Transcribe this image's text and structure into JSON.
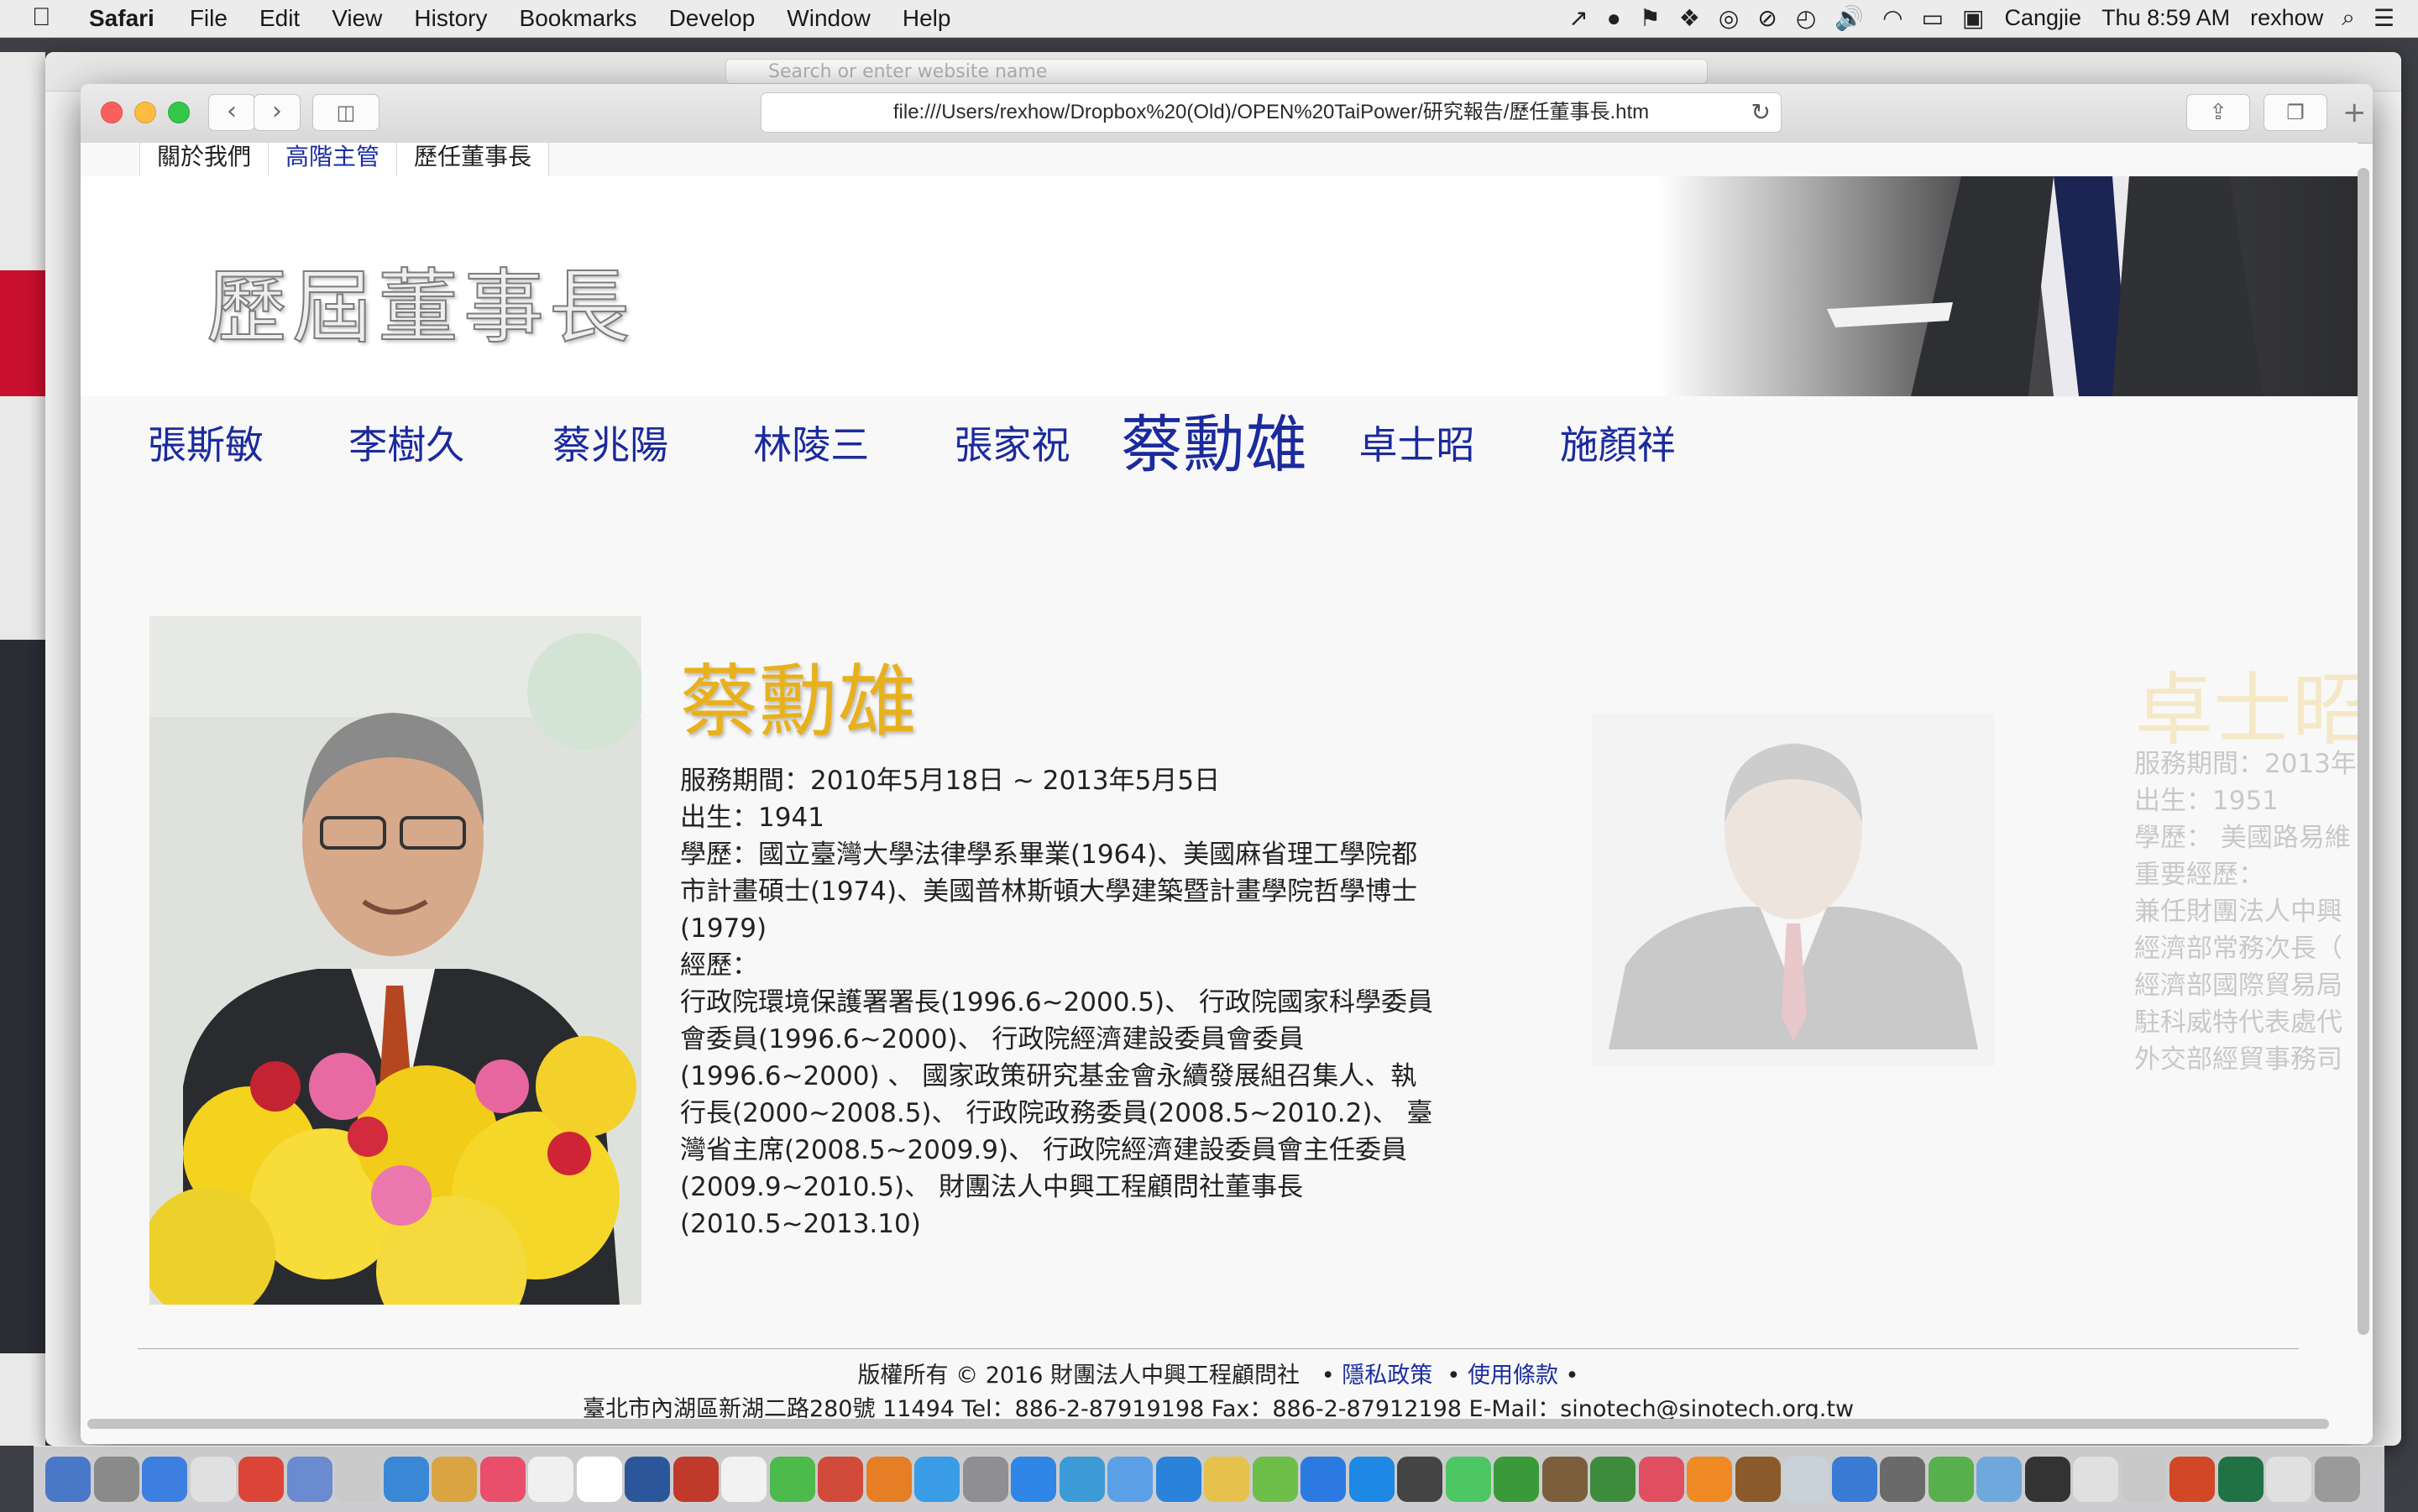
{
  "menubar": {
    "app_name": "Safari",
    "menus": [
      "File",
      "Edit",
      "View",
      "History",
      "Bookmarks",
      "Develop",
      "Window",
      "Help"
    ],
    "input_method": "Cangjie",
    "clock": "Thu 8:59 AM",
    "user": "rexhow"
  },
  "browser": {
    "url": "file:///Users/rexhow/Dropbox%20(Old)/OPEN%20TaiPower/研究報告/歷任董事長.htm",
    "background_placeholder": "Search or enter website name"
  },
  "page": {
    "top_nav": [
      "關於我們",
      "高階主管",
      "歷任董事長"
    ],
    "active_top_nav": "高階主管",
    "title": "歷屆董事長",
    "chairmen": [
      "張斯敏",
      "李樹久",
      "蔡兆陽",
      "林陵三",
      "張家祝",
      "蔡勳雄",
      "卓士昭",
      "施顏祥"
    ],
    "active_chairman": "蔡勳雄",
    "current": {
      "name": "蔡勳雄",
      "bio": [
        "服務期間：2010年5月18日 ~ 2013年5月5日",
        "出生：1941",
        "學歷：國立臺灣大學法律學系畢業(1964)、美國麻省理工學院都市計畫碩士(1974)、美國普林斯頓大學建築暨計畫學院哲學博士(1979)",
        "經歷：",
        "行政院環境保護署署長(1996.6~2000.5)、 行政院國家科學委員會委員(1996.6~2000)、 行政院經濟建設委員會委員(1996.6~2000) 、 國家政策研究基金會永續發展組召集人、執行長(2000~2008.5)、 行政院政務委員(2008.5~2010.2)、 臺灣省主席(2008.5~2009.9)、 行政院經濟建設委員會主任委員(2009.9~2010.5)、 財團法人中興工程顧問社董事長(2010.5~2013.10)"
      ]
    },
    "next": {
      "name": "卓士昭",
      "bio": [
        "服務期間：2013年",
        "出生：1951",
        "學歷： 美國路易維",
        "重要經歷：",
        "兼任財團法人中興",
        "經濟部常務次長（",
        "經濟部國際貿易局",
        "駐科威特代表處代",
        "外交部經貿事務司"
      ]
    },
    "footer": {
      "copyright": "版權所有 © 2016 財團法人中興工程顧問社",
      "privacy": "隱私政策",
      "terms": "使用條款",
      "address": "臺北市內湖區新湖二路280號 11494   Tel：886-2-87919198    Fax：886-2-87912198   E-Mail：sinotech@sinotech.org.tw"
    }
  },
  "colors": {
    "link_blue": "#1b2a9c",
    "name_gold": "#e8b11c"
  }
}
